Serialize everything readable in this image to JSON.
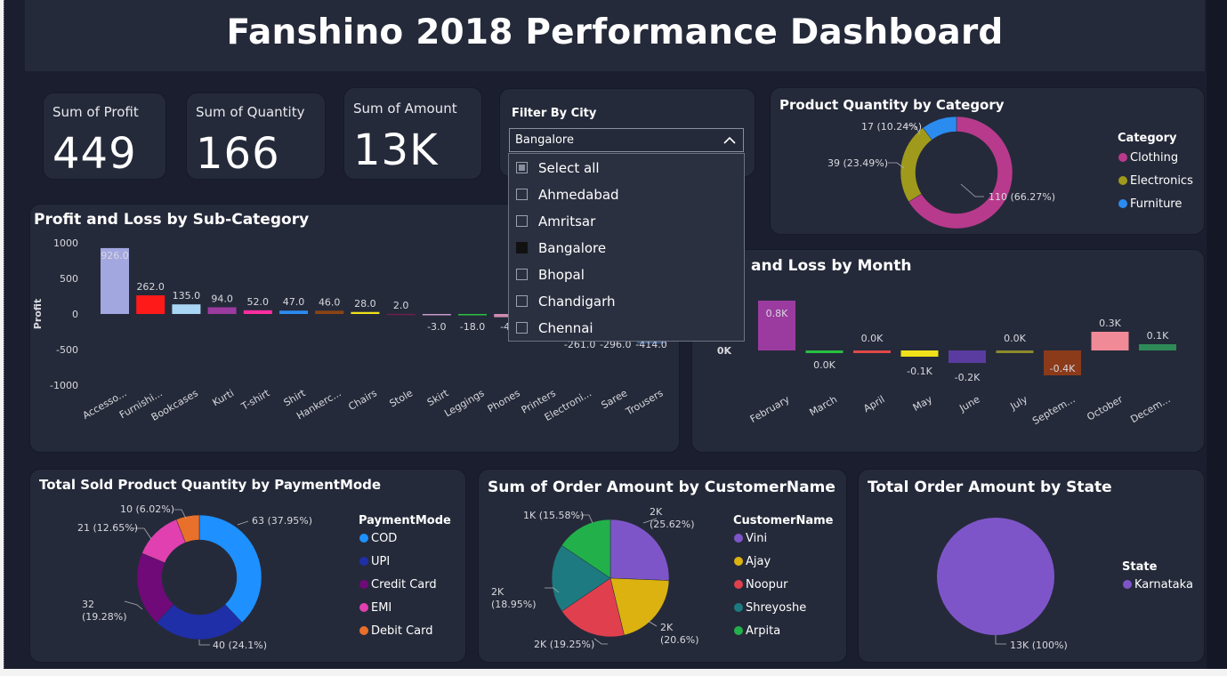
{
  "title": "Fanshino 2018 Performance Dashboard",
  "kpis": {
    "profit": {
      "label": "Sum of Profit",
      "value": "449"
    },
    "quantity": {
      "label": "Sum of Quantity",
      "value": "166"
    },
    "amount": {
      "label": "Sum of Amount",
      "value": "13K"
    }
  },
  "filter": {
    "title": "Filter By City",
    "selected": "Bangalore",
    "options": [
      "Select all",
      "Ahmedabad",
      "Amritsar",
      "Bangalore",
      "Bhopal",
      "Chandigarh",
      "Chennai"
    ]
  },
  "colors": {
    "background": "#1b1e2e",
    "card": "#252a3a",
    "text": "#ffffff"
  },
  "chart_data": [
    {
      "id": "category-donut",
      "type": "pie",
      "title": "Product Quantity by Category",
      "legend_title": "Category",
      "legend_position": "right",
      "categories": [
        "Clothing",
        "Electronics",
        "Furniture"
      ],
      "values": [
        110,
        39,
        17
      ],
      "labels": [
        "110 (66.27%)",
        "39 (23.49%)",
        "17 (10.24%)"
      ],
      "colors": [
        "#b83a8c",
        "#a09a1c",
        "#2b8cf0"
      ]
    },
    {
      "id": "subcategory-bar",
      "type": "bar",
      "title": "Profit and Loss by Sub-Category",
      "ylabel": "Profit",
      "ylim": [
        -1000,
        1000
      ],
      "yticks": [
        "1000",
        "500",
        "0",
        "-500",
        "-1000"
      ],
      "categories": [
        "Accesso...",
        "Furnishi...",
        "Bookcases",
        "Kurti",
        "T-shirt",
        "Shirt",
        "Hankerc...",
        "Chairs",
        "Stole",
        "Skirt",
        "Leggings",
        "Phones",
        "Printers",
        "Electroni...",
        "Saree",
        "Trousers"
      ],
      "values": [
        926,
        262,
        135,
        94,
        52,
        47,
        46,
        28,
        2,
        -3,
        -18,
        -45,
        -150,
        -261,
        -296,
        -414
      ],
      "labels": [
        "926.0",
        "262.0",
        "135.0",
        "94.0",
        "52.0",
        "47.0",
        "46.0",
        "28.0",
        "2.0",
        "-3.0",
        "-18.0",
        "-45",
        "",
        "-261.0",
        "-296.0",
        "-414.0"
      ],
      "colors": [
        "#a3a7e0",
        "#ff1a1a",
        "#a9d6f5",
        "#9b3ba0",
        "#ff2ea0",
        "#2b8cf0",
        "#8b4513",
        "#f0e11a",
        "#6b1f4a",
        "#c799c7",
        "#28c040",
        "#d08ab0",
        "#2e8b57",
        "#7a3a7a",
        "#5a2a5a",
        "#3a5a8a"
      ]
    },
    {
      "id": "month-bar",
      "type": "bar",
      "title": "and Loss by Month",
      "ytick_zero": "0K",
      "categories": [
        "February",
        "March",
        "April",
        "May",
        "June",
        "July",
        "Septem...",
        "October",
        "Decem..."
      ],
      "values": [
        0.8,
        0.0,
        0.0,
        -0.1,
        -0.2,
        0.0,
        -0.4,
        0.3,
        0.1
      ],
      "labels": [
        "0.8K",
        "0.0K",
        "0.0K",
        "-0.1K",
        "-0.2K",
        "0.0K",
        "-0.4K",
        "0.3K",
        "0.1K"
      ],
      "colors": [
        "#9b3ba0",
        "#28c040",
        "#e04848",
        "#f0e11a",
        "#5a3ca0",
        "#8b8b2b",
        "#8b3a1a",
        "#f08a96",
        "#2e8b57"
      ]
    },
    {
      "id": "payment-donut",
      "type": "pie",
      "title": "Total Sold Product Quantity by PaymentMode",
      "legend_title": "PaymentMode",
      "legend_position": "right",
      "categories": [
        "COD",
        "UPI",
        "Credit Card",
        "EMI",
        "Debit Card"
      ],
      "values": [
        63,
        40,
        32,
        21,
        10
      ],
      "labels": [
        "63 (37.95%)",
        "40 (24.1%)",
        "32 (19.28%)",
        "21 (12.65%)",
        "10 (6.02%)"
      ],
      "colors": [
        "#1e90ff",
        "#1f2fa8",
        "#700a78",
        "#e040b0",
        "#e8702a"
      ]
    },
    {
      "id": "customer-pie",
      "type": "pie",
      "title": "Sum of Order Amount by CustomerName",
      "legend_title": "CustomerName",
      "legend_position": "right",
      "categories": [
        "Vini",
        "Ajay",
        "Noopur",
        "Shreyoshe",
        "Arpita"
      ],
      "values": [
        25.62,
        20.6,
        19.25,
        18.95,
        15.58
      ],
      "labels": [
        "2K (25.62%)",
        "2K (20.6%)",
        "2K (19.25%)",
        "2K (18.95%)",
        "1K (15.58%)"
      ],
      "colors": [
        "#7e55c9",
        "#dbb20f",
        "#e0404e",
        "#1d7a80",
        "#22b04a"
      ]
    },
    {
      "id": "state-pie",
      "type": "pie",
      "title": "Total Order Amount by State",
      "legend_title": "State",
      "legend_position": "right",
      "categories": [
        "Karnataka"
      ],
      "values": [
        100
      ],
      "labels": [
        "13K (100%)"
      ],
      "colors": [
        "#7e55c9"
      ]
    }
  ]
}
